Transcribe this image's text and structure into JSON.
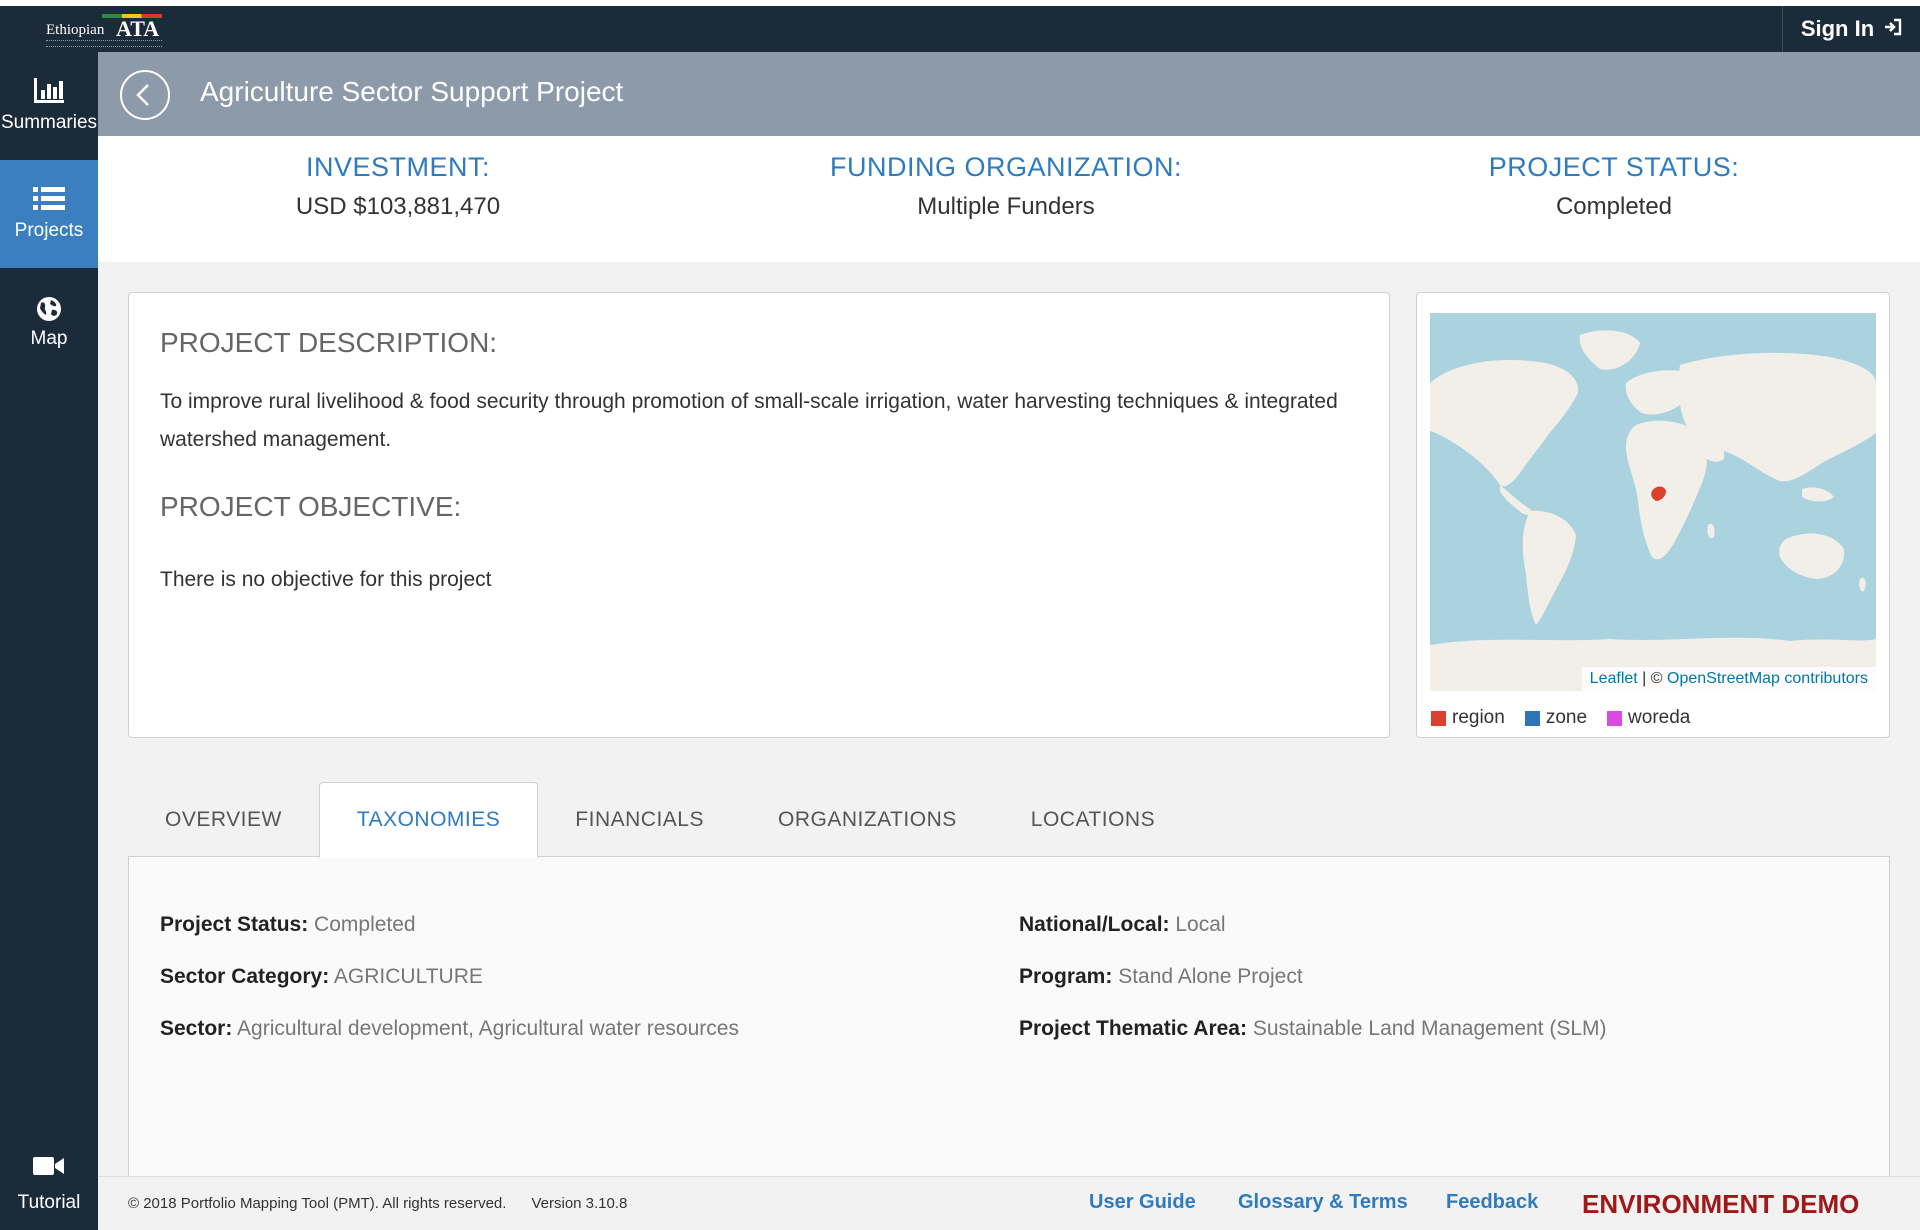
{
  "brand": {
    "logo_text": "Ethiopian",
    "logo_mark": "ATA"
  },
  "topbar": {
    "signin_label": "Sign In"
  },
  "sidebar": {
    "items": [
      {
        "label": "Summaries",
        "icon": "bar-chart-icon"
      },
      {
        "label": "Projects",
        "icon": "list-icon"
      },
      {
        "label": "Map",
        "icon": "globe-icon"
      },
      {
        "label": "Tutorial",
        "icon": "video-camera-icon"
      }
    ]
  },
  "header": {
    "title": "Agriculture Sector Support Project"
  },
  "summary": {
    "investment_label": "INVESTMENT:",
    "investment_value": "USD $103,881,470",
    "funding_label": "FUNDING ORGANIZATION:",
    "funding_value": "Multiple Funders",
    "status_label": "PROJECT STATUS:",
    "status_value": "Completed"
  },
  "description": {
    "heading": "PROJECT DESCRIPTION:",
    "text": "To improve rural livelihood & food security through promotion of small-scale irrigation, water harvesting techniques & integrated watershed management.",
    "objective_heading": "PROJECT OBJECTIVE:",
    "objective_text": "There is no objective for this project"
  },
  "map": {
    "attribution_leaflet": "Leaflet",
    "attribution_sep": " | © ",
    "attribution_osm": "OpenStreetMap contributors",
    "legend": [
      {
        "label": "region",
        "color": "#d9412e"
      },
      {
        "label": "zone",
        "color": "#2e74b8"
      },
      {
        "label": "woreda",
        "color": "#d94ae0"
      }
    ]
  },
  "tabs": [
    {
      "label": "OVERVIEW",
      "active": false
    },
    {
      "label": "TAXONOMIES",
      "active": true
    },
    {
      "label": "FINANCIALS",
      "active": false
    },
    {
      "label": "ORGANIZATIONS",
      "active": false
    },
    {
      "label": "LOCATIONS",
      "active": false
    }
  ],
  "taxonomies": {
    "left": [
      {
        "key": "Project Status:",
        "value": "Completed"
      },
      {
        "key": "Sector Category:",
        "value": "AGRICULTURE"
      },
      {
        "key": "Sector:",
        "value": "Agricultural development, Agricultural water resources"
      }
    ],
    "right": [
      {
        "key": "National/Local:",
        "value": "Local"
      },
      {
        "key": "Program:",
        "value": "Stand Alone Project"
      },
      {
        "key": "Project Thematic Area:",
        "value": "Sustainable Land Management (SLM)"
      }
    ]
  },
  "footer": {
    "copyright": "© 2018 Portfolio Mapping Tool (PMT). All rights reserved.",
    "version": "Version 3.10.8",
    "user_guide": "User Guide",
    "glossary": "Glossary & Terms",
    "feedback": "Feedback",
    "environment": "ENVIRONMENT DEMO"
  },
  "colors": {
    "nav_dark": "#1c2b3a",
    "accent_blue": "#2e7bbf",
    "header_gray": "#8d9aaa",
    "environment_red": "#a01818"
  }
}
